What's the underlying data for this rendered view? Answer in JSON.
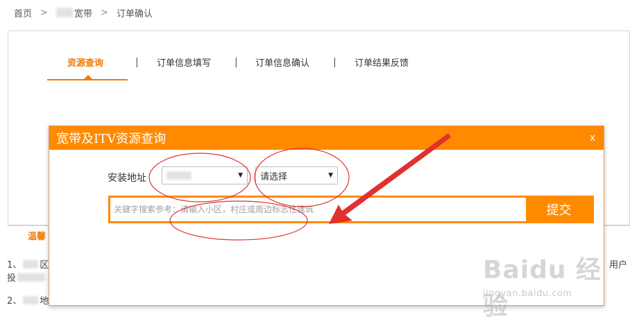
{
  "breadcrumb": {
    "home": "首页",
    "separator": ">",
    "middle": "宽带",
    "current": "订单确认"
  },
  "steps": [
    {
      "label": "资源查询",
      "active": true
    },
    {
      "label": "订单信息填写",
      "active": false
    },
    {
      "label": "订单信息确认",
      "active": false
    },
    {
      "label": "订单结果反馈",
      "active": false
    }
  ],
  "step_divider": "|",
  "background": {
    "tip_label": "温馨",
    "line1_prefix": "1、",
    "line1_suffix": "区",
    "line1_right": "，用户",
    "line1b_prefix": "投",
    "line2_prefix": "2、",
    "line2_suffix": "地"
  },
  "modal": {
    "title": "宽带及ITV资源查询",
    "close": "x",
    "address_label": "安装地址",
    "city_select": "",
    "district_select": "请选择",
    "search_placeholder": "关键字搜索参考：请输入小区，村庄或周边标志性建筑",
    "submit_label": "提交"
  },
  "watermark": {
    "logo": "Baidu 经验",
    "url": "jingyan.baidu.com"
  },
  "colors": {
    "accent": "#ff8a00",
    "active_step": "#f07c06",
    "annotation_red": "#e03030"
  }
}
